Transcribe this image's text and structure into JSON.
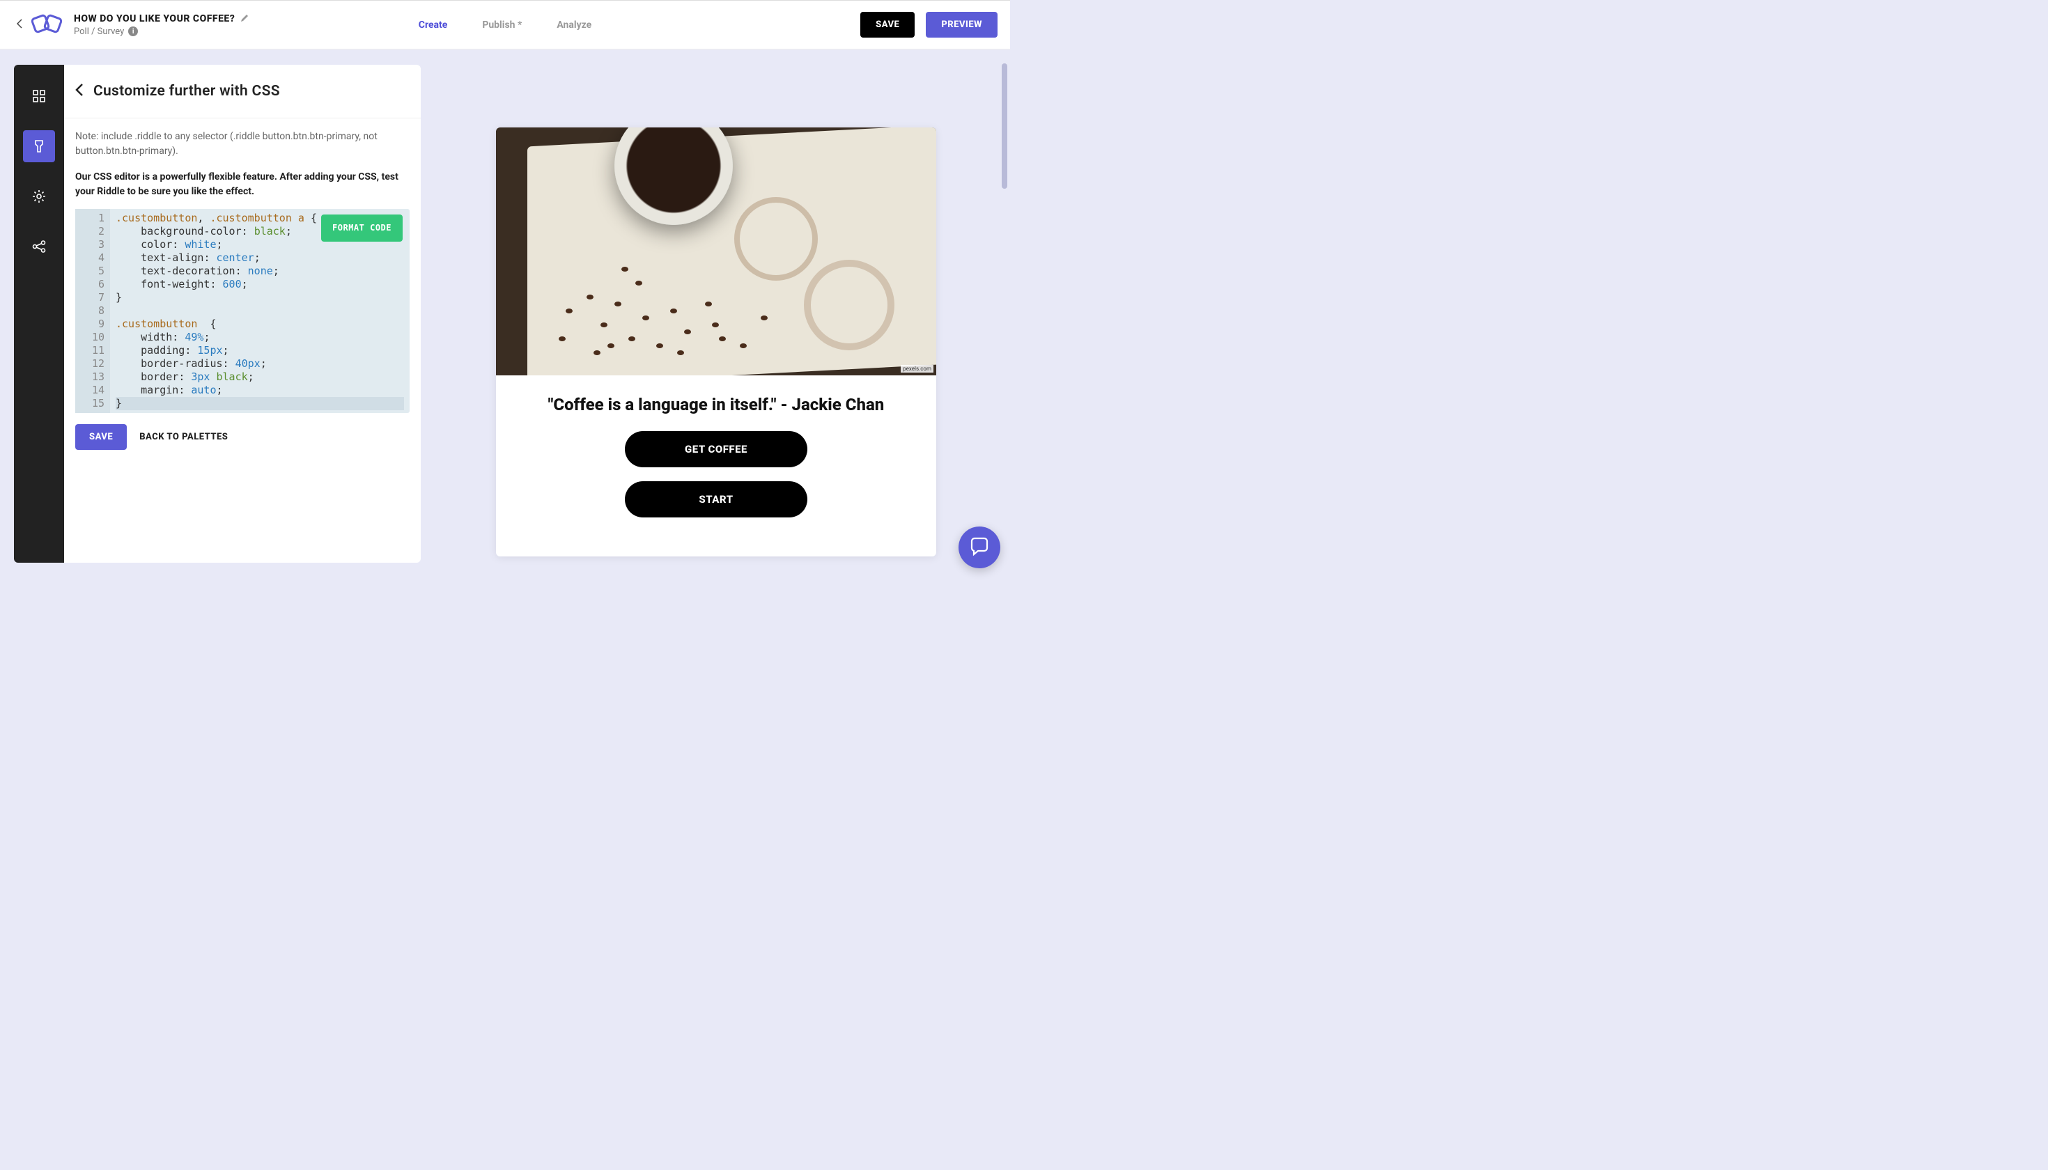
{
  "header": {
    "title": "HOW DO YOU LIKE YOUR COFFEE?",
    "subtitle": "Poll / Survey",
    "tabs": {
      "create": "Create",
      "publish": "Publish *",
      "analyze": "Analyze"
    },
    "save": "SAVE",
    "preview": "PREVIEW"
  },
  "panel": {
    "title": "Customize further with CSS",
    "note": "Note: include .riddle to any selector (.riddle button.btn.btn-primary, not button.btn.btn-primary).",
    "bold_note": "Our CSS editor is a powerfully flexible feature. After adding your CSS, test your Riddle to be sure you like the effect.",
    "format": "FORMAT CODE",
    "save": "SAVE",
    "back": "BACK TO PALETTES",
    "code_lines": [
      {
        "n": "1",
        "tokens": [
          [
            ".custombutton",
            "sel"
          ],
          [
            ", ",
            "punc"
          ],
          [
            ".custombutton",
            "sel"
          ],
          [
            " ",
            "punc"
          ],
          [
            "a",
            "sel"
          ],
          [
            " {",
            "punc"
          ]
        ]
      },
      {
        "n": "2",
        "tokens": [
          [
            "    background-color",
            "prop"
          ],
          [
            ": ",
            "punc"
          ],
          [
            "black",
            "col"
          ],
          [
            ";",
            "punc"
          ]
        ]
      },
      {
        "n": "3",
        "tokens": [
          [
            "    color",
            "prop"
          ],
          [
            ": ",
            "punc"
          ],
          [
            "white",
            "val"
          ],
          [
            ";",
            "punc"
          ]
        ]
      },
      {
        "n": "4",
        "tokens": [
          [
            "    text-align",
            "prop"
          ],
          [
            ": ",
            "punc"
          ],
          [
            "center",
            "val"
          ],
          [
            ";",
            "punc"
          ]
        ]
      },
      {
        "n": "5",
        "tokens": [
          [
            "    text-decoration",
            "prop"
          ],
          [
            ": ",
            "punc"
          ],
          [
            "none",
            "val"
          ],
          [
            ";",
            "punc"
          ]
        ]
      },
      {
        "n": "6",
        "tokens": [
          [
            "    font-weight",
            "prop"
          ],
          [
            ": ",
            "punc"
          ],
          [
            "600",
            "num"
          ],
          [
            ";",
            "punc"
          ]
        ]
      },
      {
        "n": "7",
        "tokens": [
          [
            "}",
            "punc"
          ]
        ]
      },
      {
        "n": "8",
        "tokens": [
          [
            "",
            "punc"
          ]
        ]
      },
      {
        "n": "9",
        "tokens": [
          [
            ".custombutton",
            "sel"
          ],
          [
            "  {",
            "punc"
          ]
        ]
      },
      {
        "n": "10",
        "tokens": [
          [
            "    width",
            "prop"
          ],
          [
            ": ",
            "punc"
          ],
          [
            "49%",
            "num"
          ],
          [
            ";",
            "punc"
          ]
        ]
      },
      {
        "n": "11",
        "tokens": [
          [
            "    padding",
            "prop"
          ],
          [
            ": ",
            "punc"
          ],
          [
            "15px",
            "num"
          ],
          [
            ";",
            "punc"
          ]
        ]
      },
      {
        "n": "12",
        "tokens": [
          [
            "    border-radius",
            "prop"
          ],
          [
            ": ",
            "punc"
          ],
          [
            "40px",
            "num"
          ],
          [
            ";",
            "punc"
          ]
        ]
      },
      {
        "n": "13",
        "tokens": [
          [
            "    border",
            "prop"
          ],
          [
            ": ",
            "punc"
          ],
          [
            "3px",
            "num"
          ],
          [
            " ",
            "punc"
          ],
          [
            "black",
            "col"
          ],
          [
            ";",
            "punc"
          ]
        ]
      },
      {
        "n": "14",
        "tokens": [
          [
            "    margin",
            "prop"
          ],
          [
            ": ",
            "punc"
          ],
          [
            "auto",
            "val"
          ],
          [
            ";",
            "punc"
          ]
        ]
      },
      {
        "n": "15",
        "tokens": [
          [
            "}",
            "punc"
          ]
        ],
        "cursor": true
      }
    ]
  },
  "preview": {
    "credit": "pexels.com",
    "quote": "\"Coffee is a language in itself.\" - Jackie Chan",
    "cta1": "GET COFFEE",
    "cta2": "START"
  }
}
